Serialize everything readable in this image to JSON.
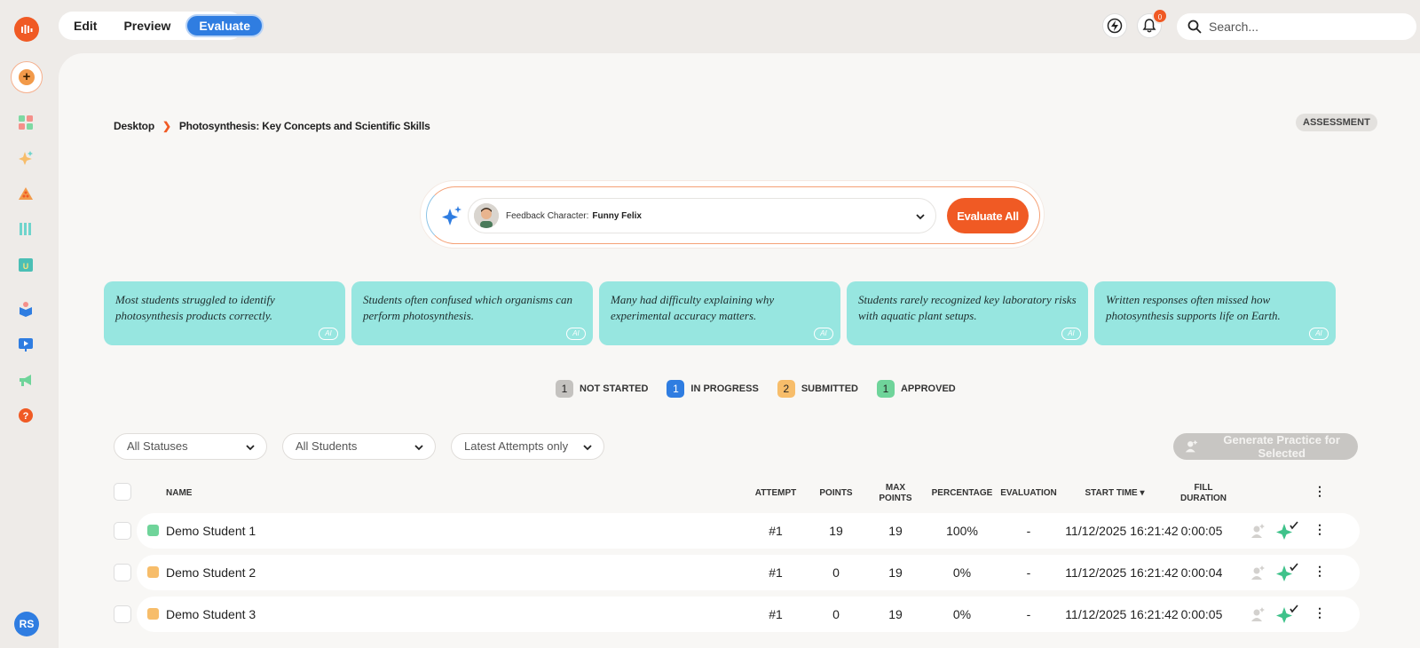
{
  "rail": {
    "avatar_initials": "RS",
    "icons": [
      "logo-icon",
      "add-icon",
      "dashboard-icon",
      "sparkle-icon",
      "shapes-icon",
      "library-icon",
      "unit-icon",
      "cube-icon",
      "presentation-icon",
      "megaphone-icon",
      "help-icon"
    ]
  },
  "modes": {
    "edit": "Edit",
    "preview": "Preview",
    "evaluate": "Evaluate"
  },
  "header": {
    "notification_badge": "0",
    "search_placeholder": "Search..."
  },
  "breadcrumb": {
    "root": "Desktop",
    "current": "Photosynthesis: Key Concepts and Scientific Skills"
  },
  "tag": "ASSESSMENT",
  "feedback": {
    "label": "Feedback Character:",
    "value": "Funny Felix",
    "evaluate_all": "Evaluate All"
  },
  "insights": [
    {
      "text": "Most students struggled to identify photosynthesis products correctly.",
      "badge": "AI"
    },
    {
      "text": "Students often confused which organisms can perform photosynthesis.",
      "badge": "AI"
    },
    {
      "text": "Many had difficulty explaining why experimental accuracy matters.",
      "badge": "AI"
    },
    {
      "text": "Students rarely recognized key laboratory risks with aquatic plant setups.",
      "badge": "AI"
    },
    {
      "text": "Written responses often missed how photosynthesis supports life on Earth.",
      "badge": "AI"
    }
  ],
  "status_legend": [
    {
      "count": "1",
      "label": "NOT STARTED",
      "color": "#c4c2bf"
    },
    {
      "count": "1",
      "label": "IN PROGRESS",
      "color": "#2f7de1"
    },
    {
      "count": "2",
      "label": "SUBMITTED",
      "color": "#f7bd6a"
    },
    {
      "count": "1",
      "label": "APPROVED",
      "color": "#6fd49a"
    }
  ],
  "filters": {
    "status": "All Statuses",
    "students": "All Students",
    "attempts": "Latest Attempts only",
    "generate": "Generate Practice for Selected"
  },
  "table": {
    "headers": {
      "name": "NAME",
      "attempt": "ATTEMPT",
      "points": "POINTS",
      "max_points_1": "MAX",
      "max_points_2": "POINTS",
      "percentage": "PERCENTAGE",
      "evaluation": "EVALUATION",
      "start_time": "START TIME ▾",
      "fill_duration_1": "FILL",
      "fill_duration_2": "DURATION"
    },
    "rows": [
      {
        "name": "Demo Student 1",
        "status_color": "#6fd49a",
        "attempt": "#1",
        "points": "19",
        "max_points": "19",
        "percentage": "100%",
        "evaluation": "-",
        "start_time": "11/12/2025 16:21:42",
        "duration": "0:00:05"
      },
      {
        "name": "Demo Student 2",
        "status_color": "#f7bd6a",
        "attempt": "#1",
        "points": "0",
        "max_points": "19",
        "percentage": "0%",
        "evaluation": "-",
        "start_time": "11/12/2025 16:21:42",
        "duration": "0:00:04"
      },
      {
        "name": "Demo Student 3",
        "status_color": "#f7bd6a",
        "attempt": "#1",
        "points": "0",
        "max_points": "19",
        "percentage": "0%",
        "evaluation": "-",
        "start_time": "11/12/2025 16:21:42",
        "duration": "0:00:05"
      }
    ]
  }
}
